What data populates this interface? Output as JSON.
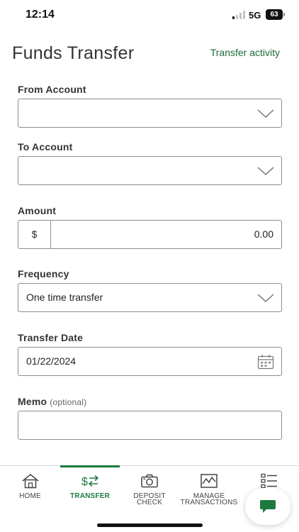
{
  "status_bar": {
    "time": "12:14",
    "network": "5G",
    "battery": "63"
  },
  "header": {
    "title": "Funds Transfer",
    "activity_link": "Transfer activity"
  },
  "form": {
    "from_account": {
      "label": "From Account",
      "value": ""
    },
    "to_account": {
      "label": "To Account",
      "value": ""
    },
    "amount": {
      "label": "Amount",
      "currency_symbol": "$",
      "value": "0.00"
    },
    "frequency": {
      "label": "Frequency",
      "value": "One time transfer"
    },
    "transfer_date": {
      "label": "Transfer Date",
      "value": "01/22/2024"
    },
    "memo": {
      "label": "Memo",
      "optional": "(optional)",
      "value": ""
    }
  },
  "tabs": [
    {
      "label": "HOME",
      "icon": "home-icon",
      "active": false
    },
    {
      "label": "TRANSFER",
      "icon": "transfer-icon",
      "active": true
    },
    {
      "label": "DEPOSIT\nCHECK",
      "icon": "camera-icon",
      "active": false
    },
    {
      "label": "MANAGE\nTRANSACTIONS",
      "icon": "chart-icon",
      "active": false
    },
    {
      "label": "",
      "icon": "menu-list-icon",
      "active": false
    }
  ],
  "colors": {
    "accent": "#1b7a3f",
    "link": "#1b6b3a",
    "border": "#8d8d8d"
  },
  "chat": {
    "icon": "chat-bubble-icon"
  }
}
